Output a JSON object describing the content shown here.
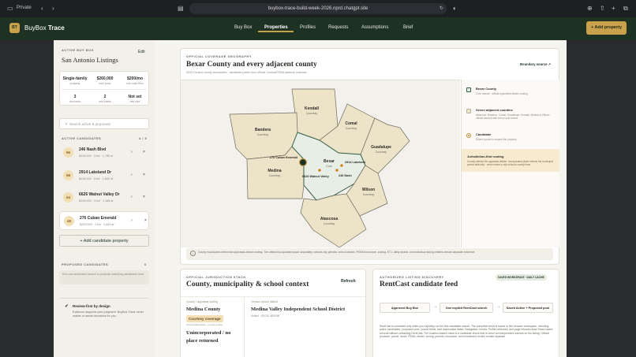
{
  "browser": {
    "private_label": "Private",
    "url": "buybox-trace-build-week-2026.nprd.chatgpt.site"
  },
  "app": {
    "logo": "BT",
    "brand_name": "BuyBox",
    "brand_suffix": "Trace",
    "nav": [
      "Buy Box",
      "Properties",
      "Profiles",
      "Requests",
      "Assumptions",
      "Brief"
    ],
    "active_nav": "Properties",
    "add_property": "+ Add property"
  },
  "sidebar": {
    "section_label": "ACTIVE BUY BOX",
    "edit": "Edit",
    "buybox_name": "San Antonio Listings",
    "stats": [
      {
        "value": "Single-family",
        "key": "property"
      },
      {
        "value": "$260,000",
        "key": "max price"
      },
      {
        "value": "$200/mo",
        "key": "min cash flow"
      },
      {
        "value": "3",
        "key": "min beds"
      },
      {
        "value": "2",
        "key": "min baths"
      },
      {
        "value": "Not set",
        "key": "min size"
      }
    ],
    "search_placeholder": "Search active & proposed",
    "active_label": "ACTIVE CANDIDATES",
    "active_count": "4 / 5",
    "candidates": [
      {
        "score": "56",
        "name": "246 Nash Blvd",
        "details": "$115,000 · 3 bd · 1,780 sf"
      },
      {
        "score": "58",
        "name": "2914 Lakeland Dr",
        "details": "$115,000 · 3 bd · 1,500 sf"
      },
      {
        "score": "54",
        "name": "6626 Walnut Valley Dr",
        "details": "$149,000 · 4 bd · 1,186 sf"
      },
      {
        "score": "48",
        "name": "276 Cuban Emerald",
        "details": "$229,000 · 3 bd · 1,653 sf"
      }
    ],
    "add_candidate": "+ Add candidate property",
    "proposed_label": "PROPOSED CANDIDATES",
    "proposed_count": "0",
    "proposed_note": "Run one authorized search to propose matching candidates here.",
    "review_title": "Review-first by design",
    "review_text": "Evidence supports your judgment. BuyBox Trace never makes or sends decisions for you."
  },
  "coverage": {
    "label": "OFFICIAL COVERAGE GEOGRAPHY",
    "title": "Bexar County and every adjacent county",
    "subtitle": "2020 Census county boundaries · candidate points from official Census/FEMA address matches",
    "boundary_source": "Boundary source ↗",
    "legend": [
      {
        "title": "Bexar County",
        "desc": "Core market · official equivalent district routing"
      },
      {
        "title": "Seven adjacent counties",
        "desc": "Atascosa, Bandera, Comal, Guadalupe, Kendall, Medina & Wilson · official handoff with every local review"
      },
      {
        "title": "Candidate",
        "desc": "Select a point to inspect the property"
      }
    ],
    "routing_title": "Jurisdiction-first routing",
    "routing_text": "County selects the appraisal district. Incorporated place selects the municipal permit authority · never where a city schools county lines.",
    "footnote": "County boundaries determine appraisal-district routing. The official incorporated place separately controls city permits; school district, FEMA flood zone, zoning, ETJ, utility district, and individual taxing entities remain separate evidence.",
    "counties": [
      {
        "name": "Kendall",
        "sub": "Courtesy"
      },
      {
        "name": "Comal",
        "sub": "Courtesy"
      },
      {
        "name": "Bandera",
        "sub": "Courtesy"
      },
      {
        "name": "Guadalupe",
        "sub": "Courtesy"
      },
      {
        "name": "Medina",
        "sub": "Courtesy"
      },
      {
        "name": "Bexar",
        "sub": "Core"
      },
      {
        "name": "Wilson",
        "sub": "Courtesy"
      },
      {
        "name": "Atascosa",
        "sub": "Courtesy"
      }
    ],
    "pins": [
      "276 Cuban Emerald",
      "2914 Lakeland",
      "6626 Walnut Valley",
      "246 Nash"
    ]
  },
  "jurisdiction": {
    "label": "OFFICIAL JURISDICTION STACK",
    "title": "County, municipality & school context",
    "refresh": "Refresh",
    "county_label": "County / appraisal routing",
    "county": "Medina County",
    "badge": "Courtesy coverage",
    "badge_sub": "Incorporated place · permit routing",
    "place": "Unincorporated / no place returned",
    "school_label": "Census school district",
    "school": "Medina Valley Independent School District",
    "school_sub": "Unified · GEOID 4829290"
  },
  "listing": {
    "label": "AUTHORIZED LISTING DISCOVERY",
    "title": "RentCast candidate feed",
    "badge": "SAVED WORKSPACE · DAILY CACHE",
    "flow": [
      "Approved Buy Box",
      "One explicit RentCast search",
      "Saved Active + Proposed pool"
    ],
    "arrow": "→",
    "desc": "RentCast is contacted only when you explicitly run the first candidate search. The complete result is saved in this browser workspace, including active candidates, proposed rows, source fields, and observation dates. Navigation, review, Profile refreshes, and page reloads reuse those saved records without contacting RentCast. The location-based check is a candidate check that is never an independent warrant on the listing. Official producer, parcel, taxes, FEMA, dealer, zoning, permits, insurance, and investment review remain separate."
  },
  "colors": {
    "forest": "#1e3224",
    "gold": "#c9a14a",
    "bexar": "#e6eee6",
    "adjacent": "#ede3c8"
  },
  "icons": [
    "back-icon",
    "forward-icon",
    "reader-icon",
    "reload-icon",
    "shield-icon",
    "download-icon",
    "share-icon",
    "new-tab-icon",
    "tabs-icon",
    "search-icon",
    "arrow-right-icon",
    "close-icon",
    "check-icon",
    "info-icon",
    "external-link-icon"
  ]
}
